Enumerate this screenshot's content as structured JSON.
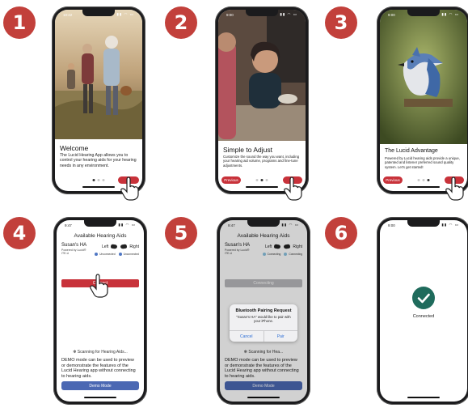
{
  "steps": {
    "one": "1",
    "two": "2",
    "three": "3",
    "four": "4",
    "five": "5",
    "six": "6"
  },
  "phones": {
    "p1": {
      "time": "10:22",
      "title": "Welcome",
      "desc": "The Lucid Hearing App allows you to control your hearing aids for your hearing needs in any environment."
    },
    "p2": {
      "time": "9:00",
      "title": "Simple to Adjust",
      "desc": "Customize the sound the way you want, including your hearing aid volume, programs and fine-tune adjustments.",
      "previous": "Previous"
    },
    "p3": {
      "time": "9:00",
      "title": "The Lucid Advantage",
      "desc": "Powered by Lucid hearing aids provide a unique, patented and listener preferred sound quality system. Let's get started!",
      "previous": "Previous"
    },
    "p4": {
      "time": "9:47",
      "header": "Available Hearing Aids",
      "device_name": "Susan's HA",
      "device_sub": "Powered by Lucid®",
      "device_model": "ITE-U",
      "left": "Left",
      "right": "Right",
      "status_left": "Unconnected",
      "status_right": "Unconnected",
      "connect": "Connect",
      "scanning": "Scanning for Hearing Aids...",
      "demo_text": "DEMO mode can be used to preview or demonstrate the features of the Lucid Hearing app without connecting to hearing aids.",
      "demo_button": "Demo Mode"
    },
    "p5": {
      "time": "9:47",
      "header": "Available Hearing Aids",
      "device_name": "Susan's HA",
      "device_sub": "Powered by Lucid®",
      "device_model": "ITE-U",
      "left": "Left",
      "right": "Right",
      "status_left": "Connecting",
      "status_right": "Connecting",
      "connecting": "Connecting",
      "alert_title": "Bluetooth Pairing Request",
      "alert_msg": "\"Susan's HA\" would like to pair with your iPhone.",
      "alert_cancel": "Cancel",
      "alert_pair": "Pair",
      "scanning": "Scanning for Hea...",
      "demo_text": "DEMO mode can be used to preview or demonstrate the features of the Lucid Hearing app without connecting to hearing aids.",
      "demo_button": "Demo Mode"
    },
    "p6": {
      "time": "9:00",
      "connected": "Connected"
    }
  },
  "colors": {
    "badge": "#c2403b",
    "accent_red": "#c8323a",
    "demo_blue": "#4b68b3",
    "check_green": "#1f6b5c",
    "status_blue": "#4f77c4"
  }
}
